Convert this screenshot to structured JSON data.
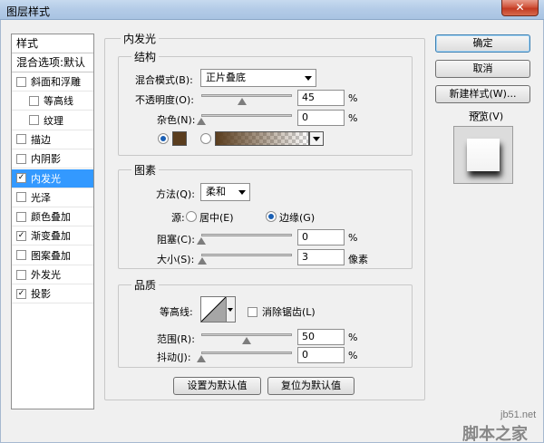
{
  "window": {
    "title": "图层样式",
    "close_glyph": "✕"
  },
  "styles_list": {
    "header": "样式",
    "blend_options": "混合选项:默认",
    "items": [
      {
        "label": "斜面和浮雕",
        "checked": false,
        "indent": false
      },
      {
        "label": "等高线",
        "checked": false,
        "indent": true
      },
      {
        "label": "纹理",
        "checked": false,
        "indent": true
      },
      {
        "label": "描边",
        "checked": false,
        "indent": false
      },
      {
        "label": "内阴影",
        "checked": false,
        "indent": false
      },
      {
        "label": "内发光",
        "checked": true,
        "indent": false,
        "selected": true
      },
      {
        "label": "光泽",
        "checked": false,
        "indent": false
      },
      {
        "label": "颜色叠加",
        "checked": false,
        "indent": false
      },
      {
        "label": "渐变叠加",
        "checked": true,
        "indent": false
      },
      {
        "label": "图案叠加",
        "checked": false,
        "indent": false
      },
      {
        "label": "外发光",
        "checked": false,
        "indent": false
      },
      {
        "label": "投影",
        "checked": true,
        "indent": false
      }
    ]
  },
  "inner_glow": {
    "title": "内发光",
    "structure": {
      "title": "结构",
      "blend_mode_label": "混合模式(B):",
      "blend_mode_value": "正片叠底",
      "opacity_label": "不透明度(O):",
      "opacity_value": "45",
      "opacity_fraction": 0.45,
      "noise_label": "杂色(N):",
      "noise_value": "0",
      "noise_fraction": 0,
      "percent": "%",
      "color_swatch": "#5a3d1e",
      "gradient_from": "#5a3d1e"
    },
    "elements": {
      "title": "图素",
      "technique_label": "方法(Q):",
      "technique_value": "柔和",
      "source_label": "源:",
      "source_center": "居中(E)",
      "source_edge": "边缘(G)",
      "choke_label": "阻塞(C):",
      "choke_value": "0",
      "choke_fraction": 0,
      "size_label": "大小(S):",
      "size_value": "3",
      "size_fraction": 0.012,
      "percent": "%",
      "pixels": "像素"
    },
    "quality": {
      "title": "品质",
      "contour_label": "等高线:",
      "antialias_label": "消除锯齿(L)",
      "range_label": "范围(R):",
      "range_value": "50",
      "range_fraction": 0.5,
      "jitter_label": "抖动(J):",
      "jitter_value": "0",
      "jitter_fraction": 0,
      "percent": "%"
    },
    "make_default": "设置为默认值",
    "reset_default": "复位为默认值"
  },
  "buttons": {
    "ok": "确定",
    "cancel": "取消",
    "new_style": "新建样式(W)...",
    "preview_label": "预览(V)"
  },
  "watermark": {
    "site": "jb51.net",
    "name": "脚本之家"
  }
}
